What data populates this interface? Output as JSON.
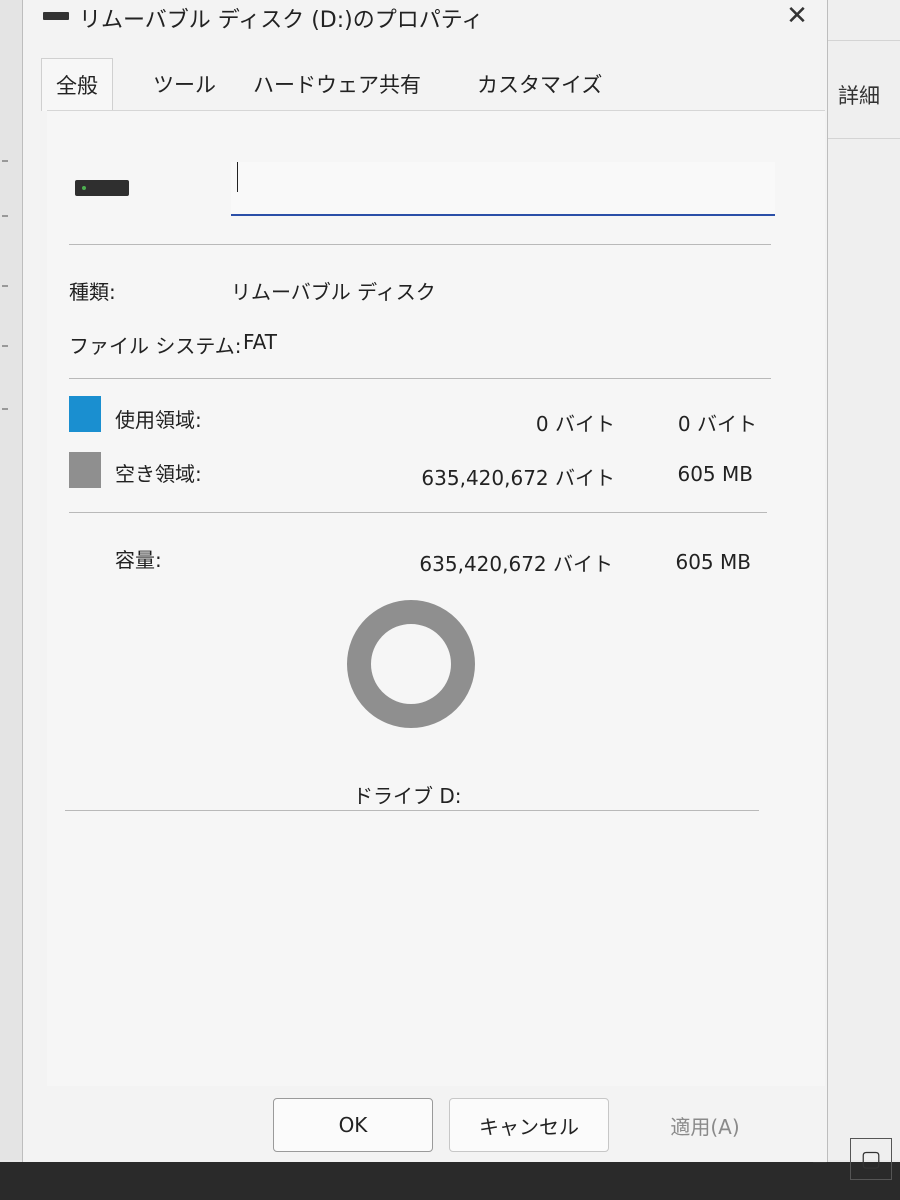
{
  "dialog": {
    "title": "リムーバブル ディスク (D:)のプロパティ",
    "close_glyph": "✕"
  },
  "tabs": [
    {
      "label": "全般",
      "active": true
    },
    {
      "label": "ツール",
      "active": false
    },
    {
      "label": "ハードウェア",
      "active": false
    },
    {
      "label": "共有",
      "active": false
    },
    {
      "label": "カスタマイズ",
      "active": false
    }
  ],
  "general": {
    "volume_label_value": "",
    "type_label": "種類:",
    "type_value": "リムーバブル ディスク",
    "fs_label": "ファイル システム:",
    "fs_value": "FAT",
    "used_label": "使用領域:",
    "used_bytes": "0 バイト",
    "used_human": "0 バイト",
    "free_label": "空き領域:",
    "free_bytes": "635,420,672 バイト",
    "free_human": "605 MB",
    "capacity_label": "容量:",
    "capacity_bytes": "635,420,672 バイト",
    "capacity_human": "605 MB",
    "drive_label": "ドライブ D:",
    "used_fraction": 0
  },
  "colors": {
    "used": "#1a8fd0",
    "free": "#8f8f8f",
    "accent": "#2b4fa8"
  },
  "buttons": {
    "ok": "OK",
    "cancel": "キャンセル",
    "apply": "適用(A)"
  },
  "background": {
    "details_label": "詳細"
  }
}
